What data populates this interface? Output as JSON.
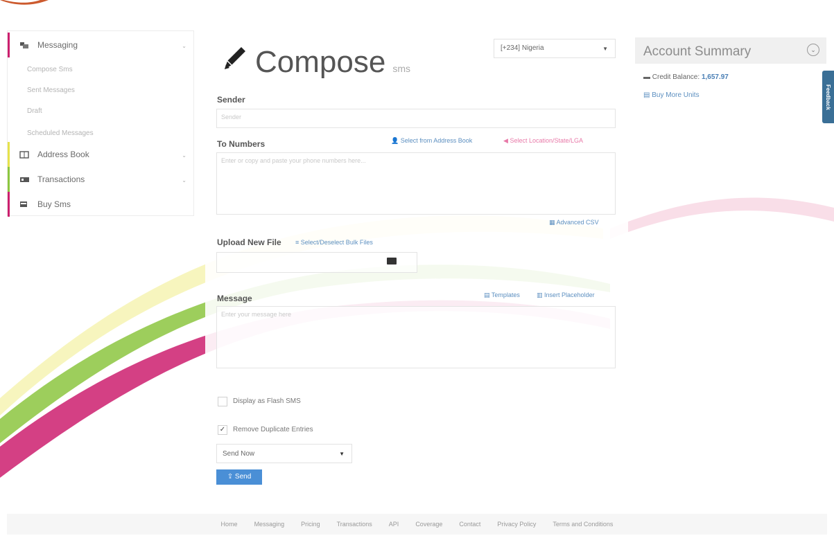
{
  "sidebar": {
    "sections": [
      {
        "label": "Messaging",
        "icon": "messaging-icon"
      },
      {
        "label": "Address Book",
        "icon": "address-book-icon"
      },
      {
        "label": "Transactions",
        "icon": "transactions-icon"
      },
      {
        "label": "Buy Sms",
        "icon": "cart-icon"
      }
    ],
    "messaging_items": [
      "Compose Sms",
      "Sent Messages",
      "Draft",
      "Scheduled Messages"
    ]
  },
  "compose": {
    "title": "Compose",
    "subtitle": "sms",
    "country": "[+234] Nigeria",
    "sender_label": "Sender",
    "sender_placeholder": "Sender",
    "to_label": "To Numbers",
    "address_book_link": "Select from Address Book",
    "location_link": "Select Location/State/LGA",
    "to_placeholder": "Enter or copy and paste your phone numbers here...",
    "advanced_csv": "Advanced CSV",
    "upload_label": "Upload New File",
    "bulk_files_link": "Select/Deselect Bulk Files",
    "message_label": "Message",
    "templates_link": "Templates",
    "placeholder_link": "Insert Placeholder",
    "message_placeholder": "Enter your message here",
    "flash_label": "Display as Flash SMS",
    "duplicate_label": "Remove Duplicate Entries",
    "send_option": "Send Now",
    "send_button": "Send"
  },
  "account": {
    "title": "Account Summary",
    "credit_label": "Credit Balance:",
    "credit_value": "1,657.97",
    "buy_units": "Buy More Units"
  },
  "feedback_tab": "Feedback",
  "footer": [
    "Home",
    "Messaging",
    "Pricing",
    "Transactions",
    "API",
    "Coverage",
    "Contact",
    "Privacy Policy",
    "Terms and Conditions"
  ],
  "colors": {
    "accent": "#4a8fd6",
    "brand_green": "#8cc63f",
    "brand_magenta": "#cc1f6e",
    "brand_yellow": "#e6e34a"
  }
}
